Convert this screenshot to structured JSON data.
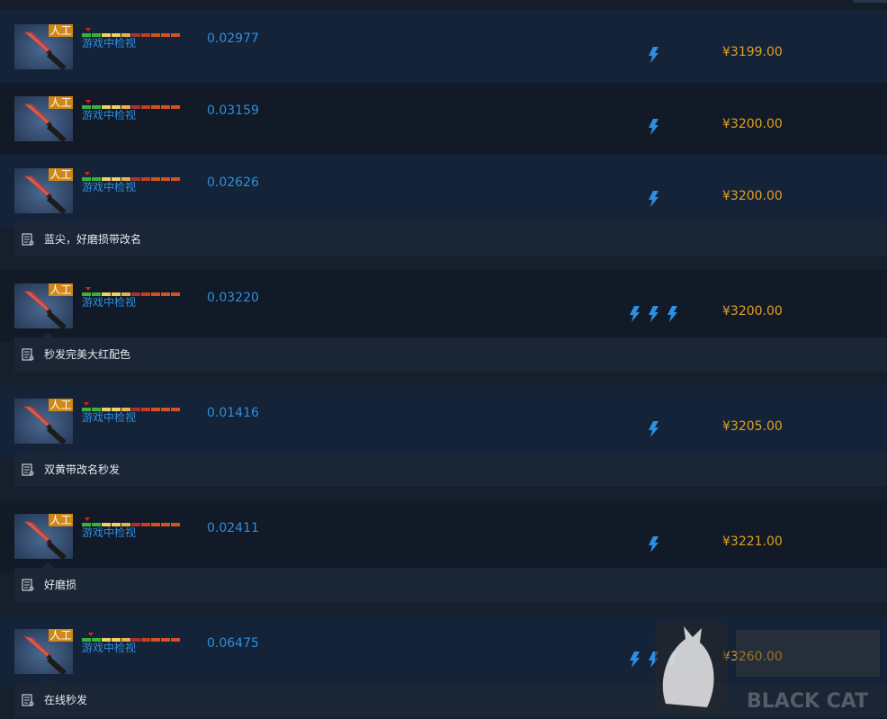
{
  "colors": {
    "page_bg": "#16202d",
    "row_bg_a": "#142338",
    "row_bg_b": "#111a26",
    "note_bg": "#1a2636",
    "badge": "#d08818",
    "link_blue": "#2e8fe0",
    "price_orange": "#e0a020",
    "bolt_blue": "#2e8fe0"
  },
  "icons": {
    "item": "knife-thumbnail",
    "bolt": "lightning-bolt-icon",
    "note": "note-icon"
  },
  "wear_scale": [
    "#3cb03c",
    "#3cb03c",
    "#f0d060",
    "#f0d060",
    "#e8b050",
    "#b03030",
    "#c83c20",
    "#d85020",
    "#d85020",
    "#d85020"
  ],
  "listings": [
    {
      "badge": "人工",
      "inspect": "游戏中检视",
      "float": "0.02977",
      "bolts": 1,
      "price": "¥3199.00",
      "note": ""
    },
    {
      "badge": "人工",
      "inspect": "游戏中检视",
      "float": "0.03159",
      "bolts": 1,
      "price": "¥3200.00",
      "note": ""
    },
    {
      "badge": "人工",
      "inspect": "游戏中检视",
      "float": "0.02626",
      "bolts": 1,
      "price": "¥3200.00",
      "note": "蓝尖，好磨损带改名"
    },
    {
      "badge": "人工",
      "inspect": "游戏中检视",
      "float": "0.03220",
      "bolts": 3,
      "price": "¥3200.00",
      "note": "秒发完美大红配色"
    },
    {
      "badge": "人工",
      "inspect": "游戏中检视",
      "float": "0.01416",
      "bolts": 1,
      "price": "¥3205.00",
      "note": "双黄带改名秒发"
    },
    {
      "badge": "人工",
      "inspect": "游戏中检视",
      "float": "0.02411",
      "bolts": 1,
      "price": "¥3221.00",
      "note": "好磨损"
    },
    {
      "badge": "人工",
      "inspect": "游戏中检视",
      "float": "0.06475",
      "bolts": 3,
      "price": "¥3260.00",
      "note": "在线秒发"
    }
  ],
  "watermark": {
    "brand": "BLACK CAT"
  }
}
